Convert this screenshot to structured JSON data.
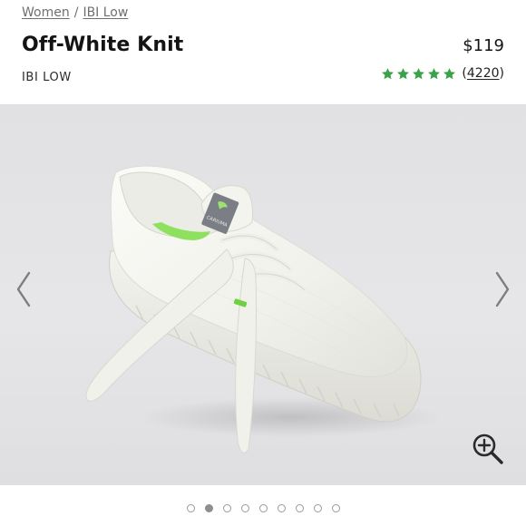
{
  "breadcrumb": {
    "items": [
      {
        "label": "Women"
      },
      {
        "label": "IBI Low"
      }
    ],
    "separator": "/"
  },
  "product": {
    "title": "Off-White Knit",
    "price": "$119",
    "subtitle": "IBI LOW",
    "rating": {
      "stars": 5,
      "review_count": "4220",
      "open_paren": "(",
      "close_paren": ")",
      "star_color": "#3aa34a"
    }
  },
  "gallery": {
    "image_alt": "Off-White Knit IBI Low sneaker",
    "tongue_label": "CARIUMA",
    "prev_icon": "chevron-left-icon",
    "next_icon": "chevron-right-icon",
    "zoom_icon": "zoom-in-icon",
    "slide_count": 9,
    "active_slide": 2,
    "accent_color": "#7ed957"
  }
}
